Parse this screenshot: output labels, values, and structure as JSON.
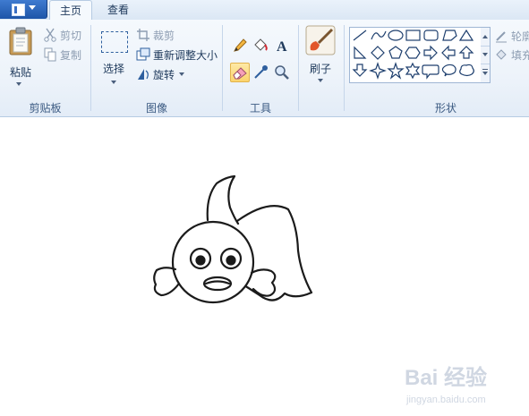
{
  "tabs": [
    {
      "label": "主页"
    },
    {
      "label": "查看"
    }
  ],
  "clipboard": {
    "group_label": "剪贴板",
    "paste_label": "粘贴",
    "cut_label": "剪切",
    "copy_label": "复制"
  },
  "image": {
    "group_label": "图像",
    "select_label": "选择",
    "crop_label": "裁剪",
    "resize_label": "重新调整大小",
    "rotate_label": "旋转"
  },
  "tools": {
    "group_label": "工具",
    "items": [
      "pencil-icon",
      "fill-bucket-icon",
      "text-icon",
      "eraser-icon",
      "color-picker-icon",
      "magnifier-icon"
    ],
    "active": "eraser-icon"
  },
  "brushes": {
    "label": "刷子"
  },
  "shapes": {
    "group_label": "形状",
    "outline_label": "轮廓",
    "fill_label": "填充"
  },
  "watermark": {
    "logo_text": "Bai 经验",
    "url": "jingyan.baidu.com"
  },
  "colors": {
    "ribbon_bg": "#edf3fa",
    "app_button": "#2a64b8",
    "active_tool": "#fbd46d",
    "canvas": "#ffffff"
  }
}
